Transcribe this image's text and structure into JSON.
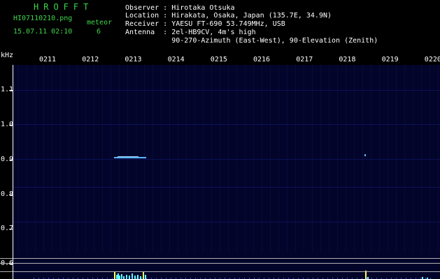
{
  "app": {
    "title": "HROFFT"
  },
  "meta": {
    "filename": "HI07110210.png",
    "datetime": "15.07.11 02:10",
    "meteor_label": "meteor",
    "meteor_count": "6"
  },
  "info": {
    "observer": "Observer : Hirotaka Otsuka",
    "location": "Location : Hirakata, Osaka, Japan (135.7E, 34.9N)",
    "receiver": "Receiver : YAESU FT-690 53.749MHz, USB",
    "antenna": "Antenna  : 2el-HB9CV, 4m's high",
    "antenna2": "           90-270-Azimuth (East-West), 90-Elevation (Zenith)"
  },
  "axis": {
    "y_unit": "kHz",
    "y_ticks": [
      "1.1",
      "1.0",
      "0.9",
      "0.8",
      "0.7",
      "0.6"
    ],
    "x_ticks": [
      "0211",
      "0212",
      "0213",
      "0214",
      "0215",
      "0216",
      "0217",
      "0218",
      "0219",
      "0220"
    ]
  },
  "colors": {
    "background": "#000000",
    "plot_background": "#03042a",
    "header_green": "#3fd64a",
    "echo": "#5ab4ff",
    "ref_line": "#b0b0b0"
  }
}
